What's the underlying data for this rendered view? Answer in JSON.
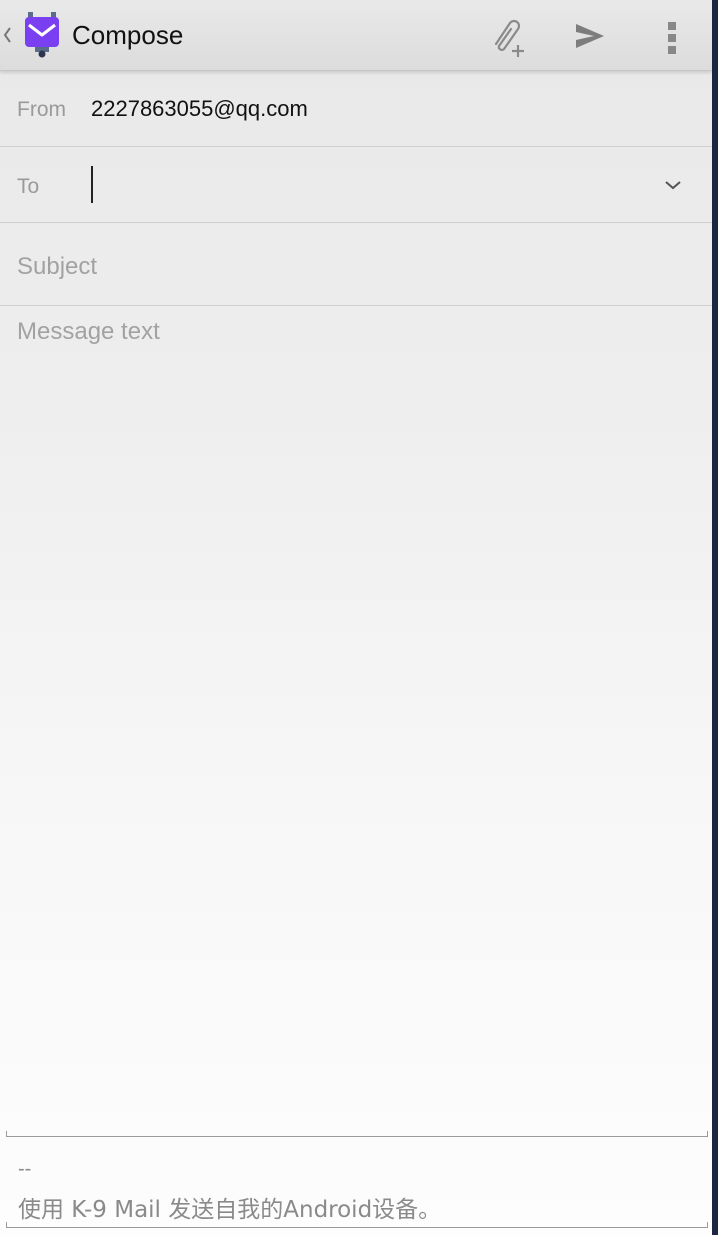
{
  "action_bar": {
    "title": "Compose",
    "icons": {
      "back": "chevron-left-icon",
      "logo": "k9-mail-logo",
      "attach": "paperclip-add-icon",
      "send": "send-icon",
      "overflow": "overflow-menu-icon"
    }
  },
  "from": {
    "label": "From",
    "value": "2227863055@qq.com"
  },
  "to": {
    "label": "To",
    "value": ""
  },
  "subject": {
    "placeholder": "Subject",
    "value": ""
  },
  "message": {
    "placeholder": "Message text",
    "value": ""
  },
  "signature": {
    "dash": "--",
    "text": "使用 K-9 Mail 发送自我的Android设备。"
  },
  "colors": {
    "logo_purple": "#7b3ff2",
    "logo_body": "#5a6b8c",
    "text_primary": "#111111",
    "text_hint": "#9a9a9a"
  }
}
